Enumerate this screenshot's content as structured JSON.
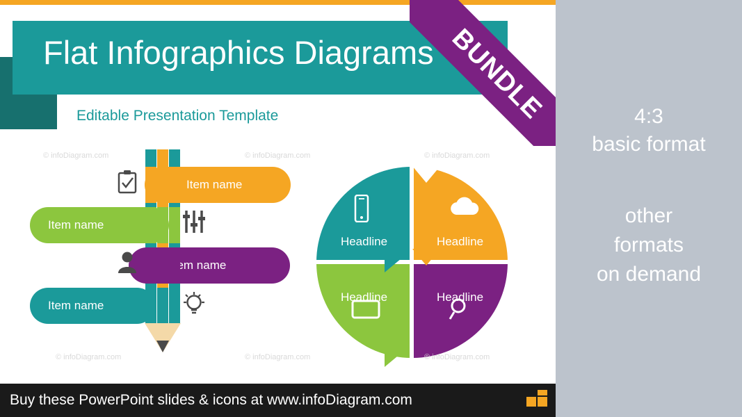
{
  "slide": {
    "title": "Flat Infographics Diagrams",
    "subtitle": "Editable Presentation Template",
    "ribbon_label": "BUNDLE",
    "accent_colors": {
      "teal": "#1b9a9a",
      "dark_teal": "#17706e",
      "orange": "#f5a623",
      "green": "#8cc63e",
      "purple": "#7b2182",
      "panel_grey": "#bcc3cc",
      "bar_black": "#1a1a1a"
    },
    "pencil_chart": {
      "bars": [
        {
          "label": "Item name",
          "color": "#f5a623",
          "side": "right",
          "icon": "clipboard-check-icon"
        },
        {
          "label": "Item name",
          "color": "#8cc63e",
          "side": "left",
          "icon": "sliders-icon"
        },
        {
          "label": "Item name",
          "color": "#7b2182",
          "side": "right",
          "icon": "person-icon"
        },
        {
          "label": "Item name",
          "color": "#1b9a9a",
          "side": "left",
          "icon": "lightbulb-icon"
        }
      ]
    },
    "circle_chart": {
      "segments": [
        {
          "label": "Headline",
          "color": "#1b9a9a",
          "icon": "smartphone-icon",
          "position": "top-left"
        },
        {
          "label": "Headline",
          "color": "#f5a623",
          "icon": "cloud-icon",
          "position": "top-right"
        },
        {
          "label": "Headline",
          "color": "#8cc63e",
          "icon": "screen-icon",
          "position": "bottom-left"
        },
        {
          "label": "Headline",
          "color": "#7b2182",
          "icon": "search-icon",
          "position": "bottom-right"
        }
      ]
    },
    "watermarks": [
      "© infoDiagram.com",
      "© infoDiagram.com",
      "© infoDiagram.com",
      "© infoDiagram.com",
      "© infoDiagram.com",
      "© infoDiagram.com"
    ],
    "footer": {
      "text": "Buy these PowerPoint slides & icons at www.infoDiagram.com",
      "logo": "infodiagram-logo-icon"
    }
  },
  "right_panel": {
    "format_line1": "4:3",
    "format_line2": "basic format",
    "other_line1": "other",
    "other_line2": "formats",
    "other_line3": "on demand"
  }
}
